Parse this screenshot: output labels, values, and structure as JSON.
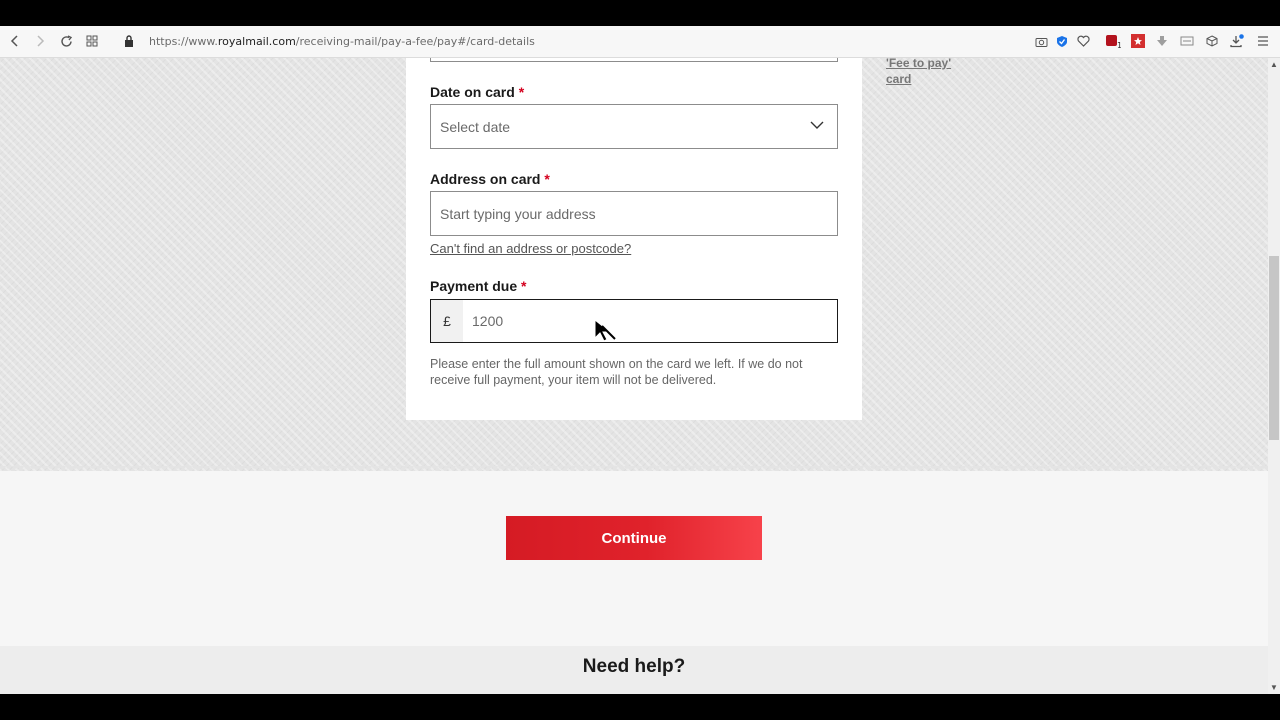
{
  "browser": {
    "url_prefix": "https://www.",
    "url_host": "royalmail.com",
    "url_path": "/receiving-mail/pay-a-fee/pay#/card-details",
    "nav_icons": [
      "back-icon",
      "forward-icon",
      "reload-icon",
      "speed-dial-icon",
      "lock-icon"
    ],
    "right_icons": [
      "camera-icon",
      "shield-icon",
      "heart-icon",
      "extension-icon",
      "bookmark-icon",
      "download-arrow-icon",
      "sun-icon",
      "cube-icon",
      "downloads-icon",
      "menu-icon"
    ],
    "extension_badge": "1"
  },
  "form": {
    "date_label": "Date on card",
    "date_placeholder": "Select date",
    "address_label": "Address on card",
    "address_placeholder": "Start typing your address",
    "address_help_link": "Can't find an address or postcode?",
    "payment_label": "Payment due",
    "currency_symbol": "£",
    "payment_value": "1200",
    "payment_hint": "Please enter the full amount shown on the card we left. If we do not receive full payment, your item will not be delivered.",
    "required_marker": "*"
  },
  "sidebar": {
    "fee_card_link_line1": "'Fee to pay'",
    "fee_card_link_line2": "card"
  },
  "actions": {
    "continue_label": "Continue"
  },
  "footer": {
    "help_title": "Need help?"
  },
  "colors": {
    "brand_red": "#e0222b",
    "required_red": "#d4001e"
  }
}
